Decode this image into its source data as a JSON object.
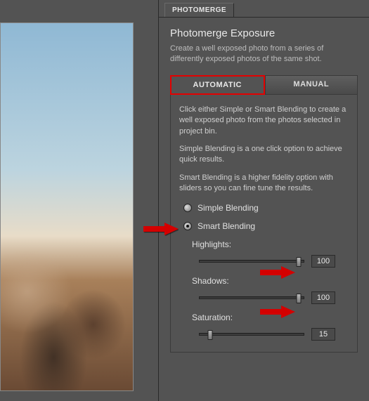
{
  "panel": {
    "tab": "PHOTOMERGE",
    "title": "Photomerge Exposure",
    "description": "Create a well exposed photo from a series of differently exposed photos of the same shot."
  },
  "modes": {
    "automatic": "AUTOMATIC",
    "manual": "MANUAL"
  },
  "content": {
    "intro1": "Click either Simple or Smart Blending to create a well exposed photo from the photos selected in project bin.",
    "intro2": "Simple Blending is a one click option to achieve quick results.",
    "intro3": "Smart Blending is a higher fidelity option with sliders so you can fine tune the results."
  },
  "blending": {
    "simple": "Simple Blending",
    "smart": "Smart Blending"
  },
  "sliders": {
    "highlights": {
      "label": "Highlights:",
      "value": "100",
      "percent": 95
    },
    "shadows": {
      "label": "Shadows:",
      "value": "100",
      "percent": 95
    },
    "saturation": {
      "label": "Saturation:",
      "value": "15",
      "percent": 10
    }
  }
}
